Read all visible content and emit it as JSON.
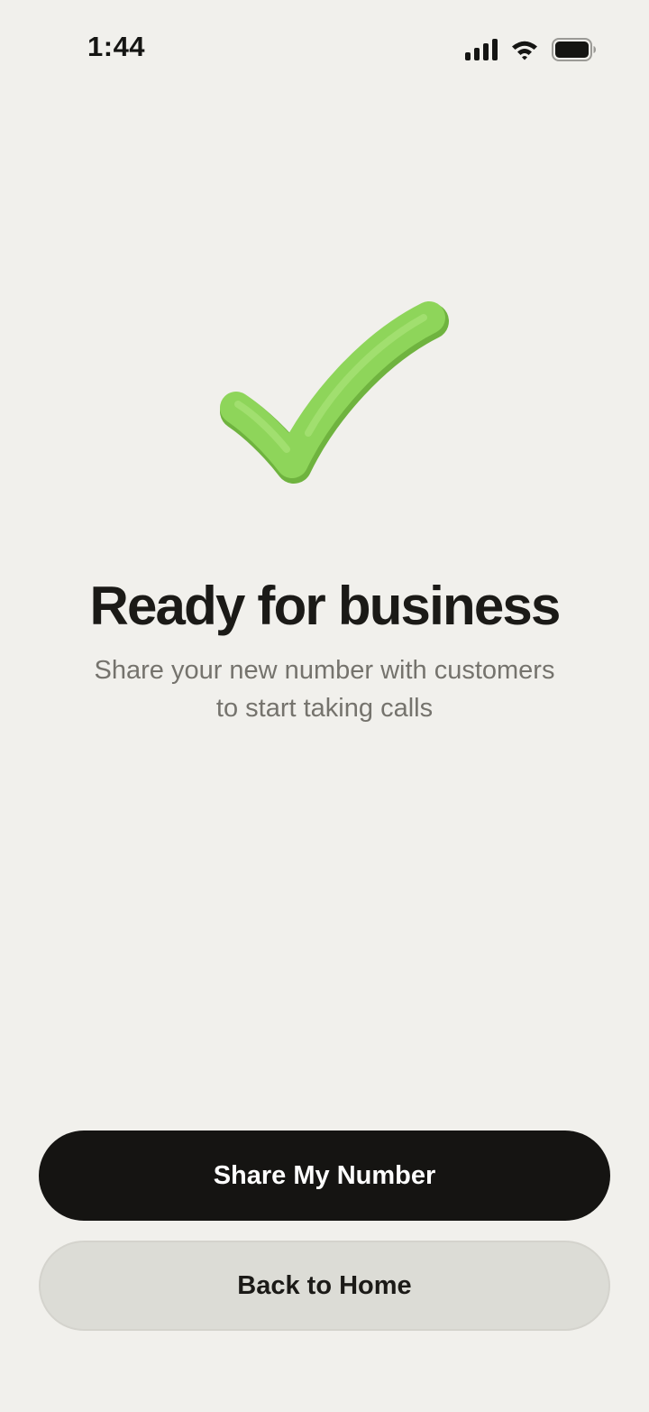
{
  "status_bar": {
    "time": "1:44",
    "icons": [
      "cellular-signal-icon",
      "wifi-icon",
      "battery-icon"
    ]
  },
  "hero": {
    "icon": "checkmark-icon",
    "color": "#8ed55a"
  },
  "content": {
    "title": "Ready for business",
    "subtitle_line1": "Share your new number with customers",
    "subtitle_line2": "to start taking calls"
  },
  "actions": {
    "primary_label": "Share My Number",
    "secondary_label": "Back to Home"
  },
  "colors": {
    "background": "#f1f0ec",
    "primary_button": "#151412",
    "secondary_button": "#dcdcd6",
    "subtitle_text": "#75736d"
  }
}
